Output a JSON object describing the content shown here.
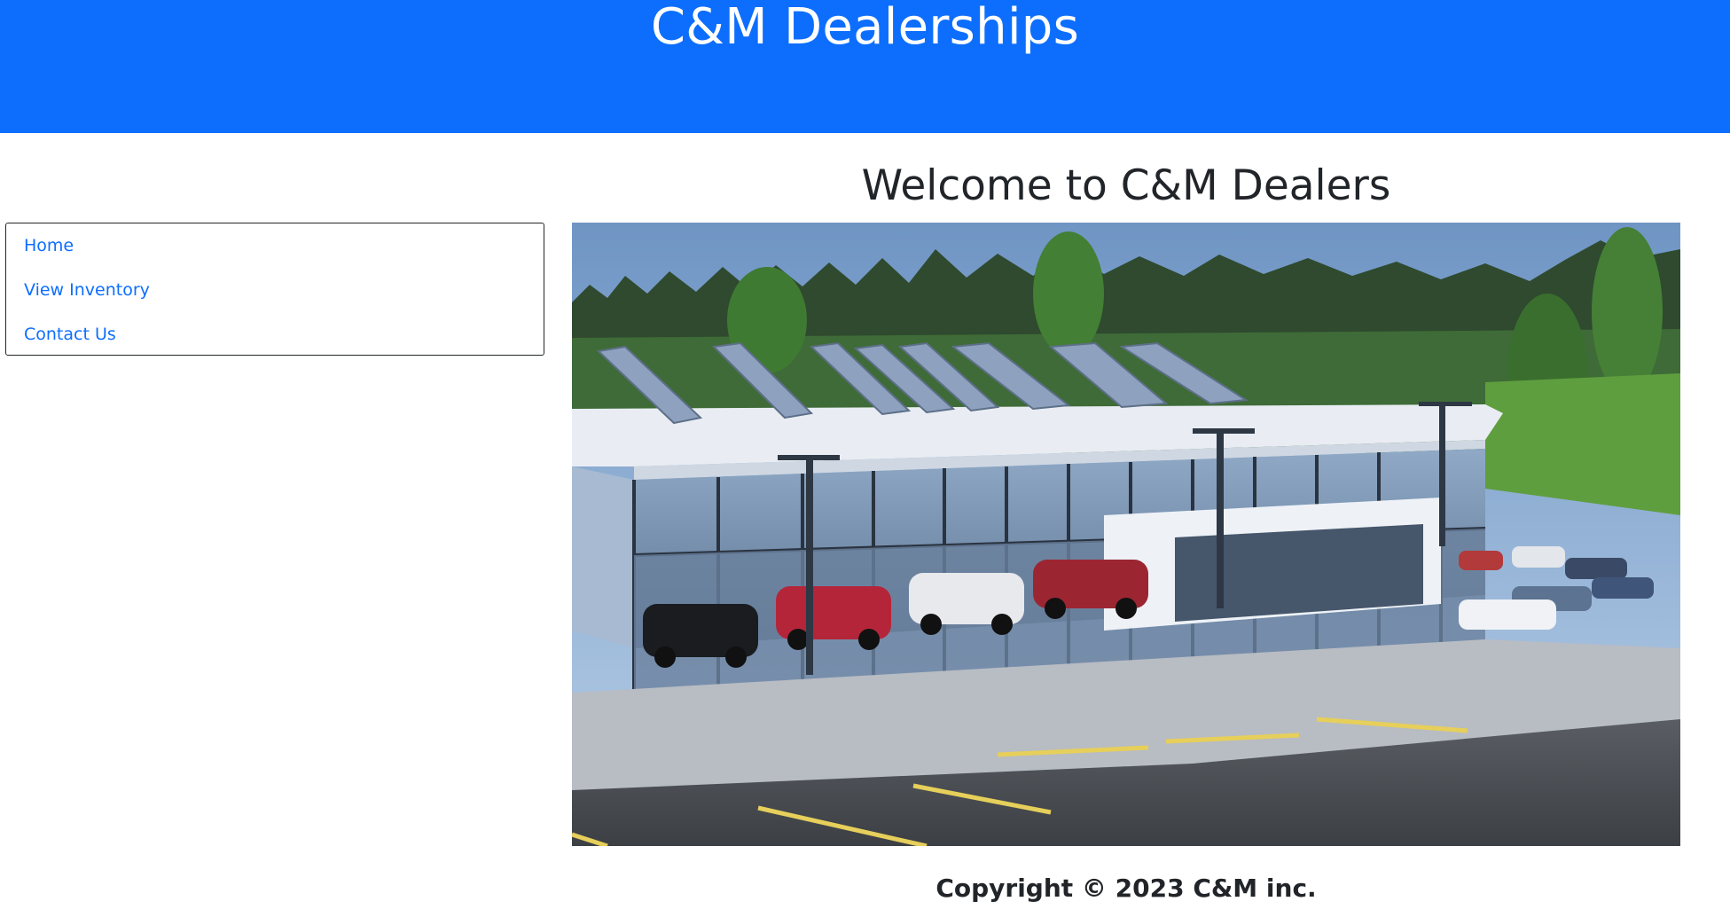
{
  "header": {
    "title": "C&M Dealerships",
    "background": "#0d6efd"
  },
  "sidebar": {
    "items": [
      {
        "label": "Home"
      },
      {
        "label": "View Inventory"
      },
      {
        "label": "Contact Us"
      }
    ],
    "link_color": "#0d6efd"
  },
  "main": {
    "heading": "Welcome to C&M Dealers"
  },
  "hero_image": {
    "subject": "car dealership building with solar panels and parked cars"
  },
  "footer": {
    "copyright": "Copyright © 2023 C&M inc."
  }
}
